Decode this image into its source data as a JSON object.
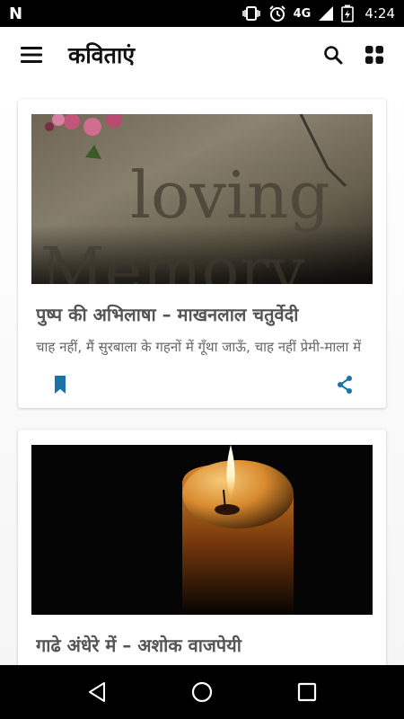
{
  "status_bar": {
    "left_icon": "n-logo",
    "network": "4G",
    "time": "4:24"
  },
  "app_bar": {
    "title": "कविताएं"
  },
  "cards": [
    {
      "title": "पुष्प की अभिलाषा –  माखनलाल चतुर्वेदी",
      "excerpt": "चाह नहीं, मैं सुरबाला के गहनों में गूँथा जाऊँ, चाह नहीं प्रेमी-माला में",
      "image_text": "loving"
    },
    {
      "title": "गाढे अंधेरे में – अशोक वाजपेयी"
    }
  ],
  "colors": {
    "accent": "#1a73a8",
    "title_text": "#555555",
    "excerpt_text": "#666666"
  },
  "nav": {
    "back_icon": "back-triangle-icon",
    "home_icon": "home-circle-icon",
    "recents_icon": "recents-square-icon"
  }
}
